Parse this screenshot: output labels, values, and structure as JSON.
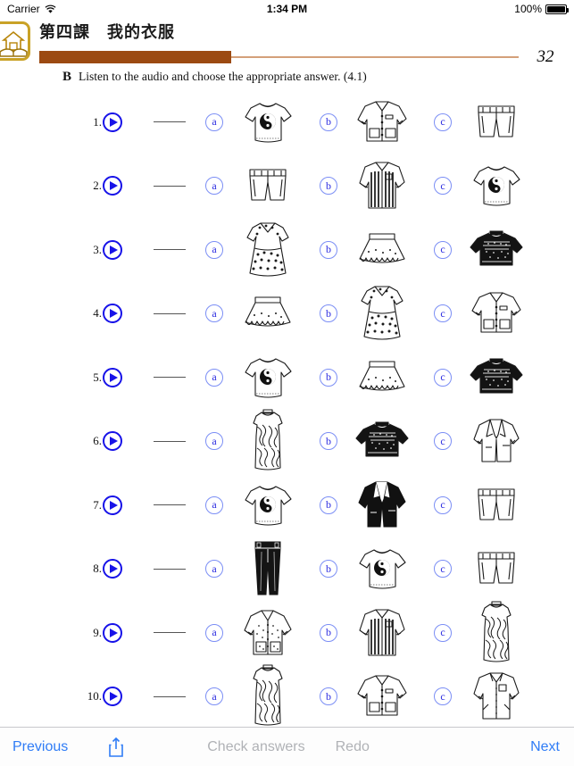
{
  "status_bar": {
    "carrier": "Carrier",
    "wifi_icon": "wifi-icon",
    "time": "1:34 PM",
    "battery_percent": "100%",
    "battery_icon": "battery-full-icon"
  },
  "header": {
    "home_icon": "home-book-icon",
    "lesson_title": "第四課　我的衣服",
    "page_number": "32",
    "progress_percent": 40,
    "progress_fill_color": "#9c4a12",
    "progress_track_color": "#d4a07a",
    "icon_border_color": "#c9a227"
  },
  "instruction": {
    "letter": "B",
    "text": "Listen to the audio and choose the appropriate answer. (4.1)"
  },
  "colors": {
    "play_blue": "#1712e8",
    "option_blue": "#2a2ae0",
    "option_ring": "#7b8ef5",
    "link_blue": "#2f7cf6",
    "disabled_gray": "#b0b2b6"
  },
  "questions": [
    {
      "number": "1.",
      "play_icon": "play-icon",
      "answer": "",
      "options": [
        {
          "label": "a",
          "image": "tshirt-yinyang"
        },
        {
          "label": "b",
          "image": "jacket-light"
        },
        {
          "label": "c",
          "image": "shorts"
        }
      ]
    },
    {
      "number": "2.",
      "play_icon": "play-icon",
      "answer": "",
      "options": [
        {
          "label": "a",
          "image": "shorts"
        },
        {
          "label": "b",
          "image": "striped-shirt"
        },
        {
          "label": "c",
          "image": "tshirt-yinyang"
        }
      ]
    },
    {
      "number": "3.",
      "play_icon": "play-icon",
      "answer": "",
      "options": [
        {
          "label": "a",
          "image": "polka-dress"
        },
        {
          "label": "b",
          "image": "skirt"
        },
        {
          "label": "c",
          "image": "dark-sweater"
        }
      ]
    },
    {
      "number": "4.",
      "play_icon": "play-icon",
      "answer": "",
      "options": [
        {
          "label": "a",
          "image": "skirt"
        },
        {
          "label": "b",
          "image": "polka-dress"
        },
        {
          "label": "c",
          "image": "jacket-light"
        }
      ]
    },
    {
      "number": "5.",
      "play_icon": "play-icon",
      "answer": "",
      "options": [
        {
          "label": "a",
          "image": "tshirt-yinyang"
        },
        {
          "label": "b",
          "image": "skirt"
        },
        {
          "label": "c",
          "image": "dark-sweater"
        }
      ]
    },
    {
      "number": "6.",
      "play_icon": "play-icon",
      "answer": "",
      "options": [
        {
          "label": "a",
          "image": "long-dress"
        },
        {
          "label": "b",
          "image": "dark-sweater"
        },
        {
          "label": "c",
          "image": "white-blazer"
        }
      ]
    },
    {
      "number": "7.",
      "play_icon": "play-icon",
      "answer": "",
      "options": [
        {
          "label": "a",
          "image": "tshirt-yinyang"
        },
        {
          "label": "b",
          "image": "black-blazer"
        },
        {
          "label": "c",
          "image": "shorts"
        }
      ]
    },
    {
      "number": "8.",
      "play_icon": "play-icon",
      "answer": "",
      "options": [
        {
          "label": "a",
          "image": "dark-pants"
        },
        {
          "label": "b",
          "image": "tshirt-yinyang"
        },
        {
          "label": "c",
          "image": "shorts"
        }
      ]
    },
    {
      "number": "9.",
      "play_icon": "play-icon",
      "answer": "",
      "options": [
        {
          "label": "a",
          "image": "patterned-jacket"
        },
        {
          "label": "b",
          "image": "striped-shirt"
        },
        {
          "label": "c",
          "image": "long-dress"
        }
      ]
    },
    {
      "number": "10.",
      "play_icon": "play-icon",
      "answer": "",
      "options": [
        {
          "label": "a",
          "image": "long-dress"
        },
        {
          "label": "b",
          "image": "jacket-light"
        },
        {
          "label": "c",
          "image": "white-shirt"
        }
      ]
    }
  ],
  "toolbar": {
    "previous_label": "Previous",
    "share_icon": "share-icon",
    "check_answers_label": "Check answers",
    "check_answers_enabled": false,
    "redo_label": "Redo",
    "redo_enabled": false,
    "next_label": "Next"
  }
}
